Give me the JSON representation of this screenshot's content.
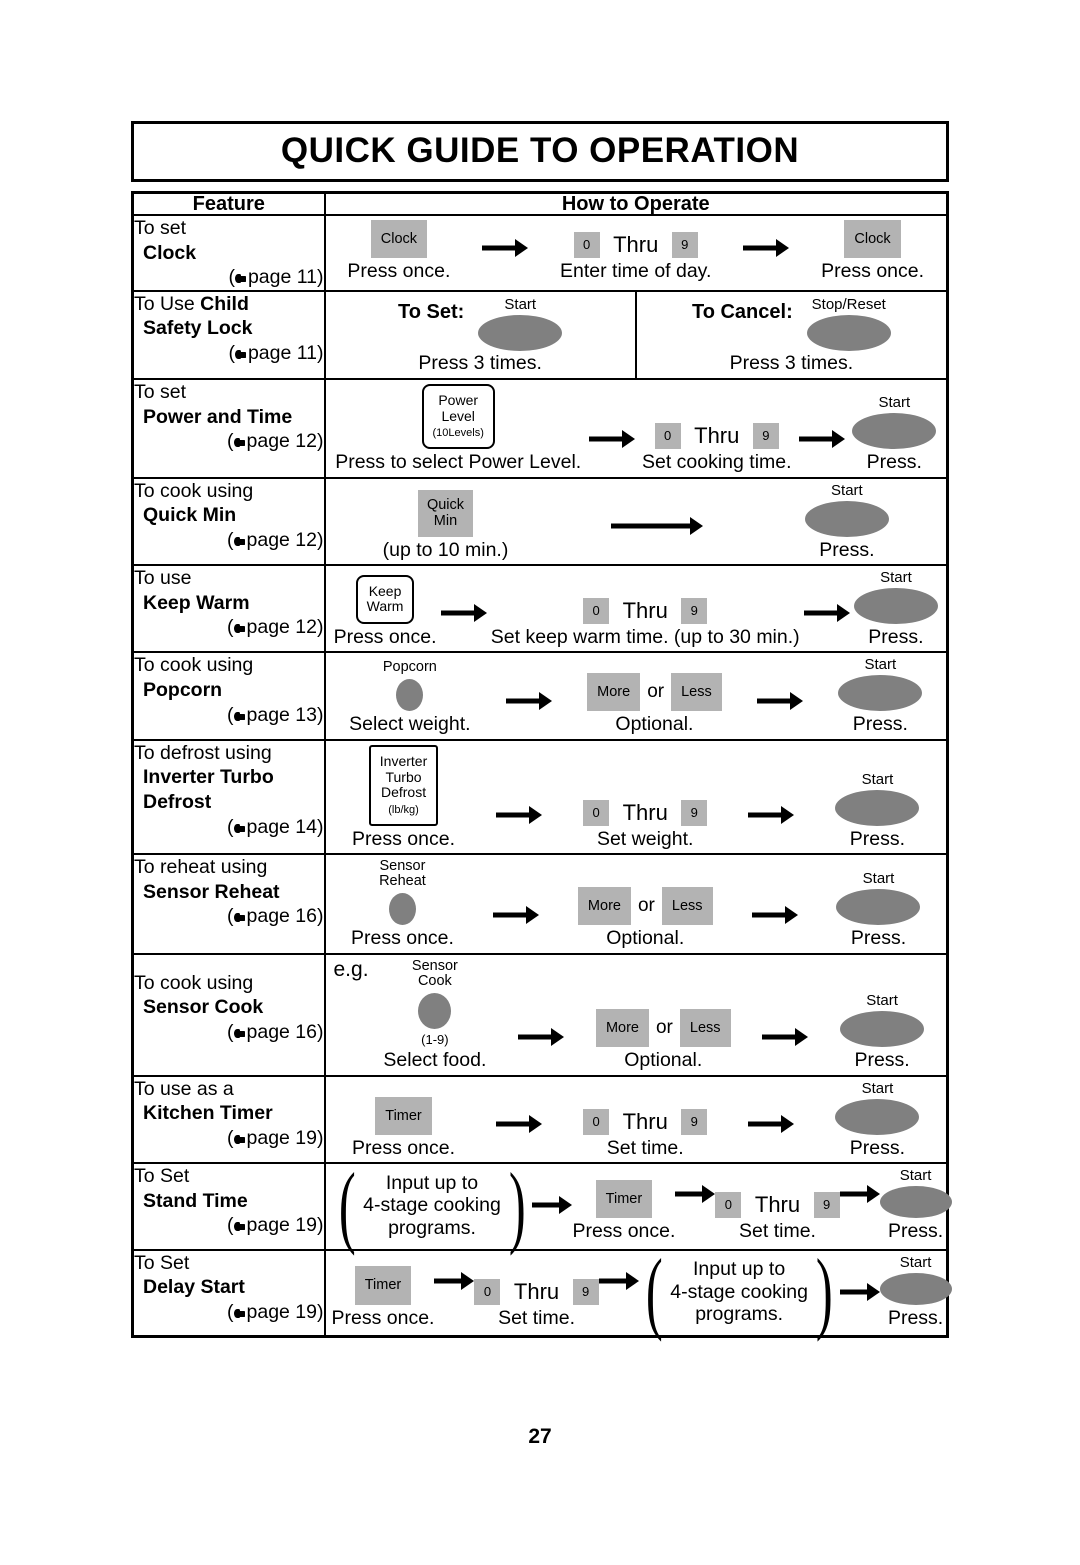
{
  "document": {
    "title": "QUICK GUIDE TO OPERATION",
    "page_number": "27"
  },
  "table": {
    "headers": {
      "feature": "Feature",
      "how_to_operate": "How to Operate"
    },
    "rows": [
      {
        "id": "clock",
        "feature": {
          "line1": "To set",
          "line2": "Clock",
          "page_ref": "page 11"
        },
        "steps": [
          {
            "key": "Clock",
            "caption": "Press once."
          },
          {
            "key_from": "0",
            "key_to": "9",
            "thru": "Thru",
            "caption": "Enter time of day."
          },
          {
            "key": "Clock",
            "caption": "Press once."
          }
        ]
      },
      {
        "id": "child-safety-lock",
        "feature": {
          "line1": "To Use ",
          "line1_bold": "Child",
          "line2": "Safety Lock",
          "page_ref": "page 11"
        },
        "set": {
          "label": "To Set:",
          "key_label": "Start",
          "caption": "Press 3 times."
        },
        "cancel": {
          "label": "To Cancel:",
          "key_label": "Stop/Reset",
          "caption": "Press 3 times."
        }
      },
      {
        "id": "power-and-time",
        "feature": {
          "line1": "To set",
          "line2": "Power and Time",
          "page_ref": "page 12"
        },
        "steps": [
          {
            "key_l1": "Power",
            "key_l2": "Level",
            "key_l3": "(10Levels)",
            "caption": "Press to select Power Level."
          },
          {
            "key_from": "0",
            "key_to": "9",
            "thru": "Thru",
            "caption": "Set cooking time."
          },
          {
            "key_label": "Start",
            "caption": "Press."
          }
        ]
      },
      {
        "id": "quick-min",
        "feature": {
          "line1": "To cook using",
          "line2": "Quick Min",
          "page_ref": "page 12"
        },
        "steps": [
          {
            "key_l1": "Quick",
            "key_l2": "Min",
            "caption": "(up to 10 min.)"
          },
          {
            "key_label": "Start",
            "caption": "Press."
          }
        ]
      },
      {
        "id": "keep-warm",
        "feature": {
          "line1": "To use",
          "line2": "Keep Warm",
          "page_ref": "page 12"
        },
        "steps": [
          {
            "key_l1": "Keep",
            "key_l2": "Warm",
            "caption": "Press once."
          },
          {
            "key_from": "0",
            "key_to": "9",
            "thru": "Thru",
            "caption": "Set keep warm time. (up to 30 min.)"
          },
          {
            "key_label": "Start",
            "caption": "Press."
          }
        ]
      },
      {
        "id": "popcorn",
        "feature": {
          "line1": "To cook using",
          "line2": "Popcorn",
          "page_ref": "page 13"
        },
        "steps": [
          {
            "pad_label": "Popcorn",
            "caption": "Select weight."
          },
          {
            "more": "More",
            "or": "or",
            "less": "Less",
            "caption": "Optional."
          },
          {
            "key_label": "Start",
            "caption": "Press."
          }
        ]
      },
      {
        "id": "inverter-turbo-defrost",
        "feature": {
          "line1": "To defrost using",
          "line2": "Inverter Turbo",
          "line3": "Defrost",
          "page_ref": "page 14"
        },
        "steps": [
          {
            "key_l1": "Inverter",
            "key_l2": "Turbo",
            "key_l3": "Defrost",
            "key_l4": "(lb/kg)",
            "caption": "Press once."
          },
          {
            "key_from": "0",
            "key_to": "9",
            "thru": "Thru",
            "caption": "Set weight."
          },
          {
            "key_label": "Start",
            "caption": "Press."
          }
        ]
      },
      {
        "id": "sensor-reheat",
        "feature": {
          "line1": "To reheat using",
          "line2": "Sensor Reheat",
          "page_ref": "page 16"
        },
        "steps": [
          {
            "pad_l1": "Sensor",
            "pad_l2": "Reheat",
            "caption": "Press once."
          },
          {
            "more": "More",
            "or": "or",
            "less": "Less",
            "caption": "Optional."
          },
          {
            "key_label": "Start",
            "caption": "Press."
          }
        ]
      },
      {
        "id": "sensor-cook",
        "feature": {
          "line1": "To cook using",
          "line2": "Sensor Cook",
          "page_ref": "page 16"
        },
        "eg": "e.g.",
        "steps": [
          {
            "pad_l1": "Sensor",
            "pad_l2": "Cook",
            "pad_note": "(1-9)",
            "caption": "Select food."
          },
          {
            "more": "More",
            "or": "or",
            "less": "Less",
            "caption": "Optional."
          },
          {
            "key_label": "Start",
            "caption": "Press."
          }
        ]
      },
      {
        "id": "kitchen-timer",
        "feature": {
          "line1": "To use as a",
          "line2": "Kitchen Timer",
          "page_ref": "page 19"
        },
        "steps": [
          {
            "key": "Timer",
            "caption": "Press once."
          },
          {
            "key_from": "0",
            "key_to": "9",
            "thru": "Thru",
            "caption": "Set time."
          },
          {
            "key_label": "Start",
            "caption": "Press."
          }
        ]
      },
      {
        "id": "stand-time",
        "feature": {
          "line1": "To Set",
          "line2": "Stand Time",
          "page_ref": "page 19"
        },
        "steps": [
          {
            "paren_l1": "Input up to",
            "paren_l2": "4-stage cooking",
            "paren_l3": "programs.",
            "caption": ""
          },
          {
            "key": "Timer",
            "caption": "Press once."
          },
          {
            "key_from": "0",
            "key_to": "9",
            "thru": "Thru",
            "caption": "Set time."
          },
          {
            "key_label": "Start",
            "caption": "Press."
          }
        ]
      },
      {
        "id": "delay-start",
        "feature": {
          "line1": "To Set",
          "line2": "Delay Start",
          "page_ref": "page 19"
        },
        "steps": [
          {
            "key": "Timer",
            "caption": "Press once."
          },
          {
            "key_from": "0",
            "key_to": "9",
            "thru": "Thru",
            "caption": "Set time."
          },
          {
            "paren_l1": "Input up to",
            "paren_l2": "4-stage cooking",
            "paren_l3": "programs.",
            "caption": ""
          },
          {
            "key_label": "Start",
            "caption": "Press."
          }
        ]
      }
    ]
  },
  "colors": {
    "key_gray": "#b3b3b3",
    "pad_gray": "#808080",
    "rule": "#000000"
  }
}
